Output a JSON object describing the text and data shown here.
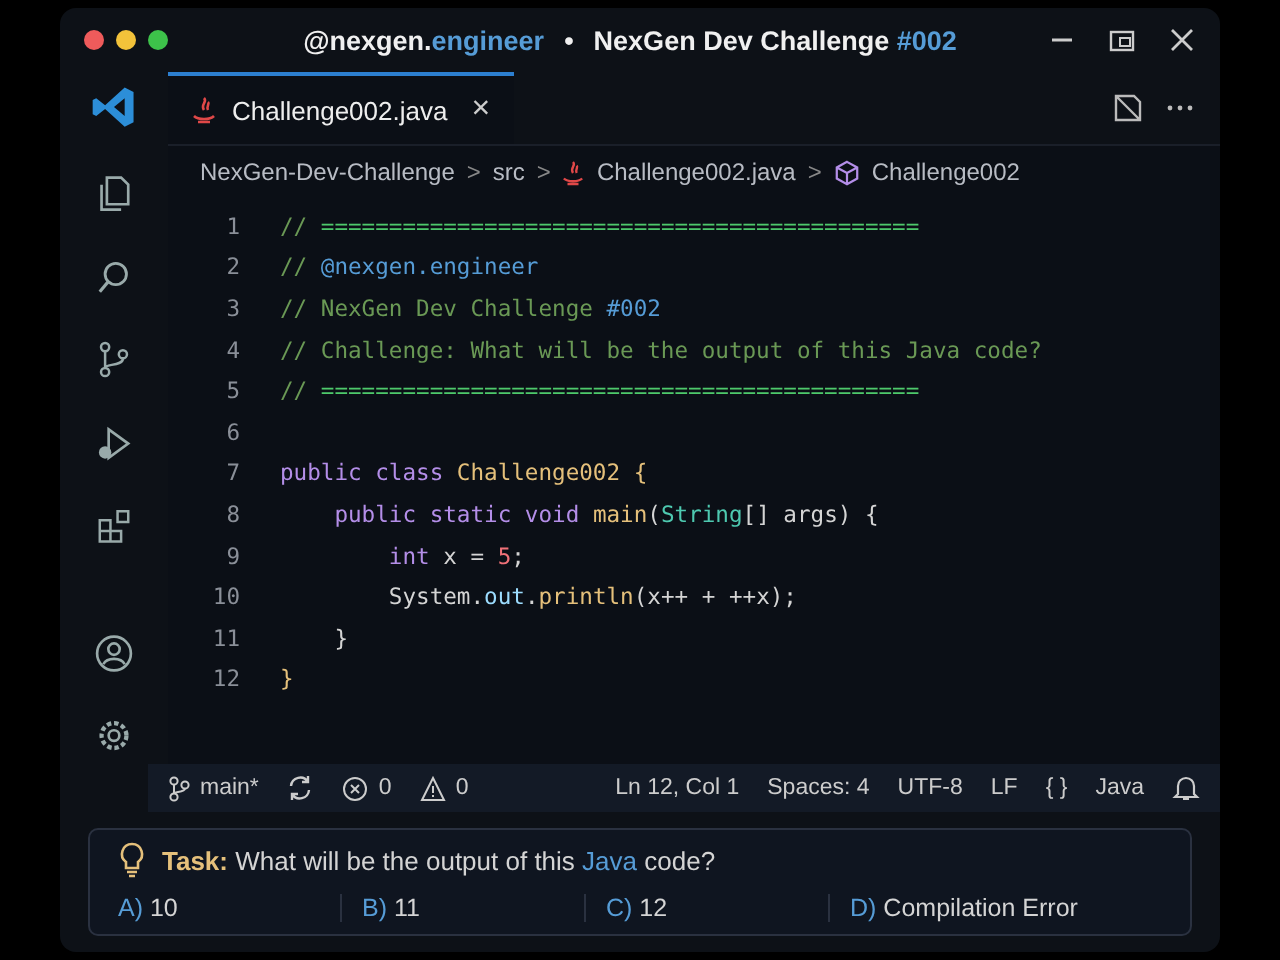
{
  "window": {
    "title": [
      {
        "text": "@nexgen.",
        "kind": "plain"
      },
      {
        "text": "engineer",
        "kind": "accent"
      }
    ],
    "separator": "•",
    "subtitle": [
      {
        "text": "NexGen Dev Challenge ",
        "kind": "plain"
      },
      {
        "text": "#002",
        "kind": "accent"
      }
    ]
  },
  "tabs": [
    {
      "label": "Challenge002.java",
      "selected": true,
      "close": "×"
    }
  ],
  "breadcrumb": [
    {
      "text": "NexGen-Dev-Challenge",
      "kind": "folder"
    },
    {
      "text": "src",
      "kind": "folder"
    },
    {
      "text": "Challenge002.java",
      "kind": "java"
    },
    {
      "text": "Challenge002",
      "kind": "class"
    }
  ],
  "breadcrumb_separator": ">",
  "code": [
    {
      "number": "1",
      "tokens": [
        {
          "text": "// ",
          "kind": "comment"
        },
        {
          "text": "============================================",
          "kind": "rule"
        }
      ]
    },
    {
      "number": "2",
      "tokens": [
        {
          "text": "// ",
          "kind": "comment"
        },
        {
          "text": "@nexgen.engineer",
          "kind": "handle"
        }
      ]
    },
    {
      "number": "3",
      "tokens": [
        {
          "text": "// NexGen Dev Challenge ",
          "kind": "comment"
        },
        {
          "text": "#002",
          "kind": "handle"
        }
      ]
    },
    {
      "number": "4",
      "tokens": [
        {
          "text": "// Challenge: What will be the output of this Java code?",
          "kind": "comment"
        }
      ]
    },
    {
      "number": "5",
      "tokens": [
        {
          "text": "// ",
          "kind": "comment"
        },
        {
          "text": "============================================",
          "kind": "rule"
        }
      ]
    },
    {
      "number": "6"
    },
    {
      "number": "7",
      "tokens": [
        {
          "text": "public class ",
          "kind": "keyword"
        },
        {
          "text": "Challenge002 ",
          "kind": "type"
        },
        {
          "text": "{",
          "kind": "brace"
        }
      ]
    },
    {
      "number": "8",
      "tokens": [
        {
          "text": "    public static void ",
          "kind": "keyword"
        },
        {
          "text": "main",
          "kind": "func"
        },
        {
          "text": "(",
          "kind": "plain"
        },
        {
          "text": "String",
          "kind": "class"
        },
        {
          "text": "[] args) {",
          "kind": "plain"
        }
      ]
    },
    {
      "number": "9",
      "tokens": [
        {
          "text": "        int ",
          "kind": "keyword"
        },
        {
          "text": "x = ",
          "kind": "plain"
        },
        {
          "text": "5",
          "kind": "number"
        },
        {
          "text": ";",
          "kind": "plain"
        }
      ]
    },
    {
      "number": "10",
      "tokens": [
        {
          "text": "        System.",
          "kind": "plain"
        },
        {
          "text": "out",
          "kind": "field"
        },
        {
          "text": ".",
          "kind": "plain"
        },
        {
          "text": "println",
          "kind": "func"
        },
        {
          "text": "(x++ + ++x);",
          "kind": "plain"
        }
      ]
    },
    {
      "number": "11",
      "tokens": [
        {
          "text": "    }",
          "kind": "plain"
        }
      ]
    },
    {
      "number": "12",
      "tokens": [
        {
          "text": "}",
          "kind": "brace"
        }
      ]
    }
  ],
  "status_bar": {
    "branch": "main*",
    "errors": "0",
    "warnings": "0",
    "position": "Ln 12, Col 1",
    "indent": "Spaces: 4",
    "encoding": "UTF-8",
    "eol": "LF",
    "language_icon": "{ }",
    "language": "Java"
  },
  "task": {
    "parts": [
      {
        "text": "Task:",
        "kind": "label"
      },
      {
        "text": " What will be the output of this ",
        "kind": "plain"
      },
      {
        "text": "Java",
        "kind": "accent"
      },
      {
        "text": " code?",
        "kind": "plain"
      }
    ],
    "options": [
      {
        "letter": "A)",
        "text": "10"
      },
      {
        "letter": "B)",
        "text": "11"
      },
      {
        "letter": "C)",
        "text": "12"
      },
      {
        "letter": "D)",
        "text": "Compilation Error"
      }
    ]
  }
}
